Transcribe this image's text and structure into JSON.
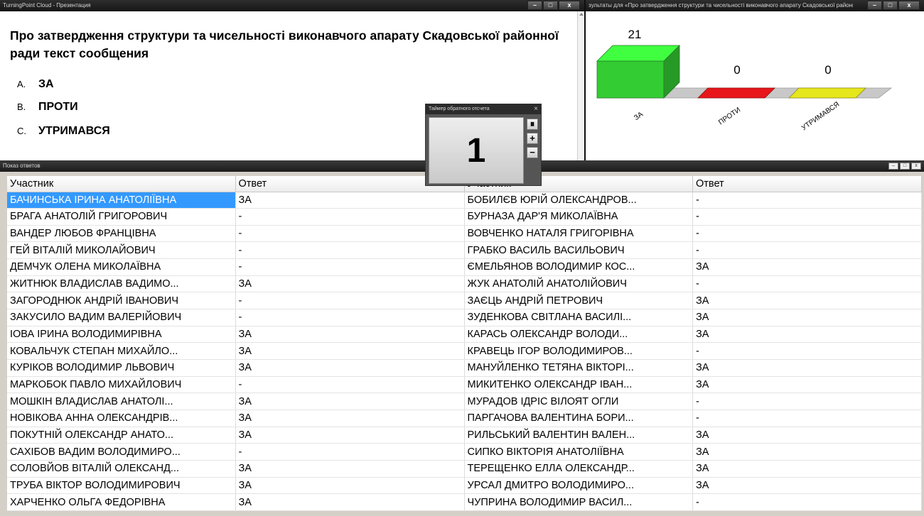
{
  "presentation": {
    "window_title": "TurningPoint Cloud - Презентация",
    "question": "Про затвердження структури та чисельності виконавчого апарату Скадовської районної ради текст сообщения",
    "choices": [
      {
        "letter": "A.",
        "text": "ЗА"
      },
      {
        "letter": "B.",
        "text": "ПРОТИ"
      },
      {
        "letter": "C.",
        "text": "УТРИМАВСЯ"
      }
    ]
  },
  "results": {
    "window_title": "зультаты для «Про затвердження структури та чисельності виконавчого апарату Скадовської районної ради текст сообщения»",
    "chart_data": {
      "type": "bar",
      "categories": [
        "ЗА",
        "ПРОТИ",
        "УТРИМАВСЯ"
      ],
      "values": [
        21,
        0,
        0
      ],
      "colors": [
        "#33cc33",
        "#e8161a",
        "#e6e61c"
      ],
      "ylim": [
        0,
        21
      ],
      "grid": false
    }
  },
  "timer": {
    "title": "Таймер обратного отсчета",
    "close": "×",
    "value": "1",
    "pause": "⏸",
    "plus": "+",
    "minus": "−"
  },
  "answers": {
    "window_title": "Показ ответов",
    "headers": {
      "participant": "Участник",
      "answer": "Ответ"
    },
    "selected_index": 0,
    "left": [
      {
        "name": "БАЧИНСЬКА ІРИНА АНАТОЛІЇВНА",
        "answer": "ЗА"
      },
      {
        "name": "БРАГА АНАТОЛІЙ ГРИГОРОВИЧ",
        "answer": "-"
      },
      {
        "name": "ВАНДЕР ЛЮБОВ ФРАНЦІВНА",
        "answer": "-"
      },
      {
        "name": "ГЕЙ ВІТАЛІЙ МИКОЛАЙОВИЧ",
        "answer": "-"
      },
      {
        "name": "ДЕМЧУК ОЛЕНА МИКОЛАЇВНА",
        "answer": "-"
      },
      {
        "name": "ЖИТНЮК ВЛАДИСЛАВ ВАДИМО...",
        "answer": "ЗА"
      },
      {
        "name": "ЗАГОРОДНЮК АНДРІЙ ІВАНОВИЧ",
        "answer": "-"
      },
      {
        "name": "ЗАКУСИЛО ВАДИМ ВАЛЕРІЙОВИЧ",
        "answer": "-"
      },
      {
        "name": "ІОВА ІРИНА ВОЛОДИМИРІВНА",
        "answer": "ЗА"
      },
      {
        "name": "КОВАЛЬЧУК СТЕПАН МИХАЙЛО...",
        "answer": "ЗА"
      },
      {
        "name": "КУРІКОВ ВОЛОДИМИР ЛЬВОВИЧ",
        "answer": "ЗА"
      },
      {
        "name": "МАРКОБОК ПАВЛО МИХАЙЛОВИЧ",
        "answer": "-"
      },
      {
        "name": "МОШКІН ВЛАДИСЛАВ АНАТОЛІ...",
        "answer": "ЗА"
      },
      {
        "name": "НОВІКОВА АННА ОЛЕКСАНДРІВ...",
        "answer": "ЗА"
      },
      {
        "name": "ПОКУТНІЙ ОЛЕКСАНДР АНАТО...",
        "answer": "ЗА"
      },
      {
        "name": "САХІБОВ ВАДИМ ВОЛОДИМИРО...",
        "answer": "-"
      },
      {
        "name": "СОЛОВЙОВ ВІТАЛІЙ ОЛЕКСАНД...",
        "answer": "ЗА"
      },
      {
        "name": "ТРУБА ВІКТОР ВОЛОДИМИРОВИЧ",
        "answer": "ЗА"
      },
      {
        "name": "ХАРЧЕНКО ОЛЬГА ФЕДОРІВНА",
        "answer": "ЗА"
      }
    ],
    "right": [
      {
        "name": "БОБИЛЄВ ЮРІЙ ОЛЕКСАНДРОВ...",
        "answer": "-"
      },
      {
        "name": "БУРНАЗА ДАР'Я МИКОЛАЇВНА",
        "answer": "-"
      },
      {
        "name": "ВОВЧЕНКО НАТАЛЯ ГРИГОРІВНА",
        "answer": "-"
      },
      {
        "name": "ГРАБКО ВАСИЛЬ ВАСИЛЬОВИЧ",
        "answer": "-"
      },
      {
        "name": "ЄМЕЛЬЯНОВ ВОЛОДИМИР КОС...",
        "answer": "ЗА"
      },
      {
        "name": "ЖУК АНАТОЛІЙ АНАТОЛІЙОВИЧ",
        "answer": "-"
      },
      {
        "name": "ЗАЄЦЬ АНДРІЙ ПЕТРОВИЧ",
        "answer": "ЗА"
      },
      {
        "name": "ЗУДЕНКОВА СВІТЛАНА ВАСИЛІ...",
        "answer": "ЗА"
      },
      {
        "name": "КАРАСЬ ОЛЕКСАНДР ВОЛОДИ...",
        "answer": "ЗА"
      },
      {
        "name": "КРАВЕЦЬ ІГОР ВОЛОДИМИРОВ...",
        "answer": "-"
      },
      {
        "name": "МАНУЙЛЕНКО ТЕТЯНА ВІКТОРІ...",
        "answer": "ЗА"
      },
      {
        "name": "МИКИТЕНКО ОЛЕКСАНДР ІВАН...",
        "answer": "ЗА"
      },
      {
        "name": "МУРАДОВ ІДРІС ВІЛОЯТ ОГЛИ",
        "answer": "-"
      },
      {
        "name": "ПАРГАЧОВА ВАЛЕНТИНА БОРИ...",
        "answer": "-"
      },
      {
        "name": "РИЛЬСЬКИЙ ВАЛЕНТИН ВАЛЕН...",
        "answer": "ЗА"
      },
      {
        "name": "СИПКО ВІКТОРІЯ АНАТОЛІЇВНА",
        "answer": "ЗА"
      },
      {
        "name": "ТЕРЕЩЕНКО ЕЛЛА ОЛЕКСАНДР...",
        "answer": "ЗА"
      },
      {
        "name": "УРСАЛ ДМИТРО ВОЛОДИМИРО...",
        "answer": "ЗА"
      },
      {
        "name": "ЧУПРИНА ВОЛОДИМИР ВАСИЛ...",
        "answer": "-"
      }
    ]
  },
  "window_controls": {
    "minimize": "–",
    "maximize": "□",
    "close": "x"
  }
}
